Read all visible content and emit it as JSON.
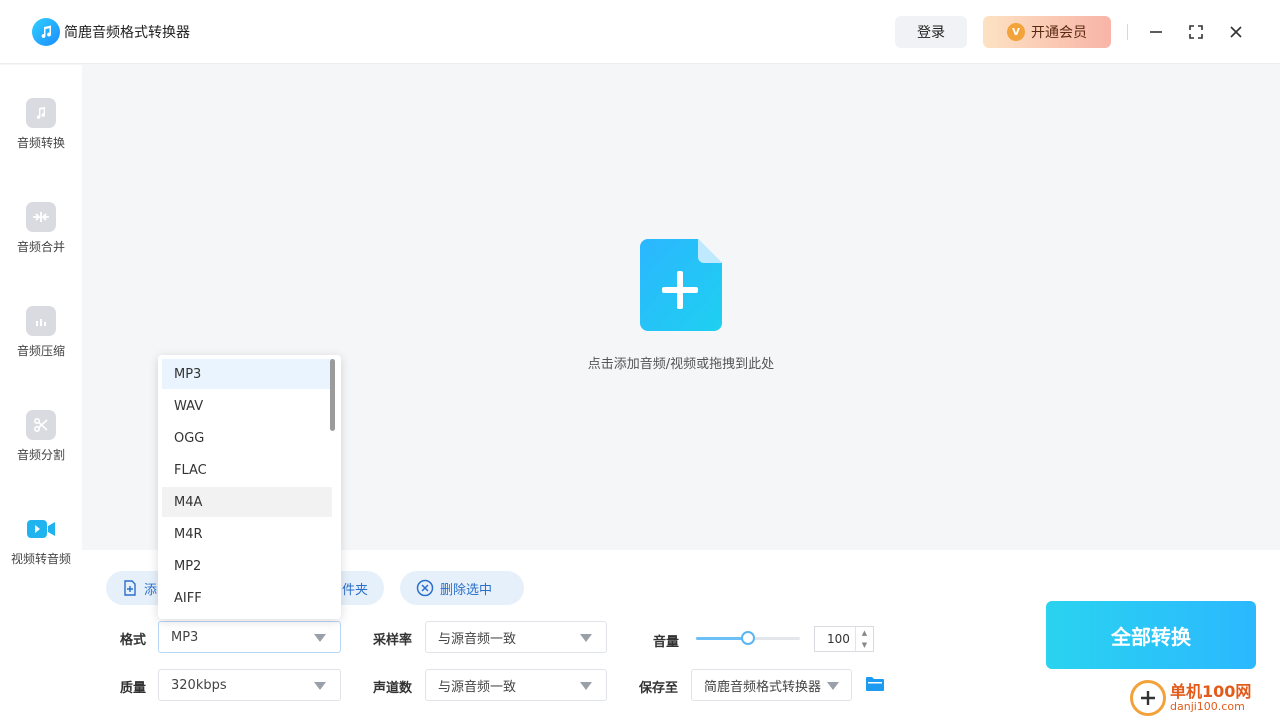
{
  "app": {
    "title": "简鹿音频格式转换器"
  },
  "header": {
    "login_label": "登录",
    "vip_label": "开通会员",
    "vip_badge": "V"
  },
  "sidebar": {
    "items": [
      {
        "label": "音频转换",
        "icon": "music-note-icon"
      },
      {
        "label": "音频合并",
        "icon": "merge-icon"
      },
      {
        "label": "音频压缩",
        "icon": "compress-icon"
      },
      {
        "label": "音频分割",
        "icon": "scissors-icon"
      },
      {
        "label": "视频转音频",
        "icon": "video-camera-icon"
      }
    ],
    "active_index": 4
  },
  "dropzone": {
    "hint": "点击添加音频/视频或拖拽到此处"
  },
  "actions": {
    "add_file_partial": "添",
    "add_folder_partial": "件夹",
    "delete_selected": "删除选中"
  },
  "settings": {
    "format_label": "格式",
    "format_value": "MP3",
    "quality_label": "质量",
    "quality_value": "320kbps",
    "sample_rate_label": "采样率",
    "sample_rate_value": "与源音频一致",
    "channels_label": "声道数",
    "channels_value": "与源音频一致",
    "volume_label": "音量",
    "volume_value": "100",
    "volume_level_fraction": 0.5,
    "save_to_label": "保存至",
    "save_to_value": "简鹿音频格式转换器"
  },
  "convert_all_label": "全部转换",
  "format_dropdown": {
    "options": [
      "MP3",
      "WAV",
      "OGG",
      "FLAC",
      "M4A",
      "M4R",
      "MP2",
      "AIFF"
    ],
    "selected": "MP3",
    "hovered": "M4A"
  },
  "watermark": {
    "name": "单机100网",
    "url": "danji100.com"
  },
  "colors": {
    "accent": "#2bb8ff",
    "vip_gradient_start": "#fde2c2",
    "vip_gradient_end": "#f8b4a8",
    "brand_blue": "#1a8cff"
  }
}
